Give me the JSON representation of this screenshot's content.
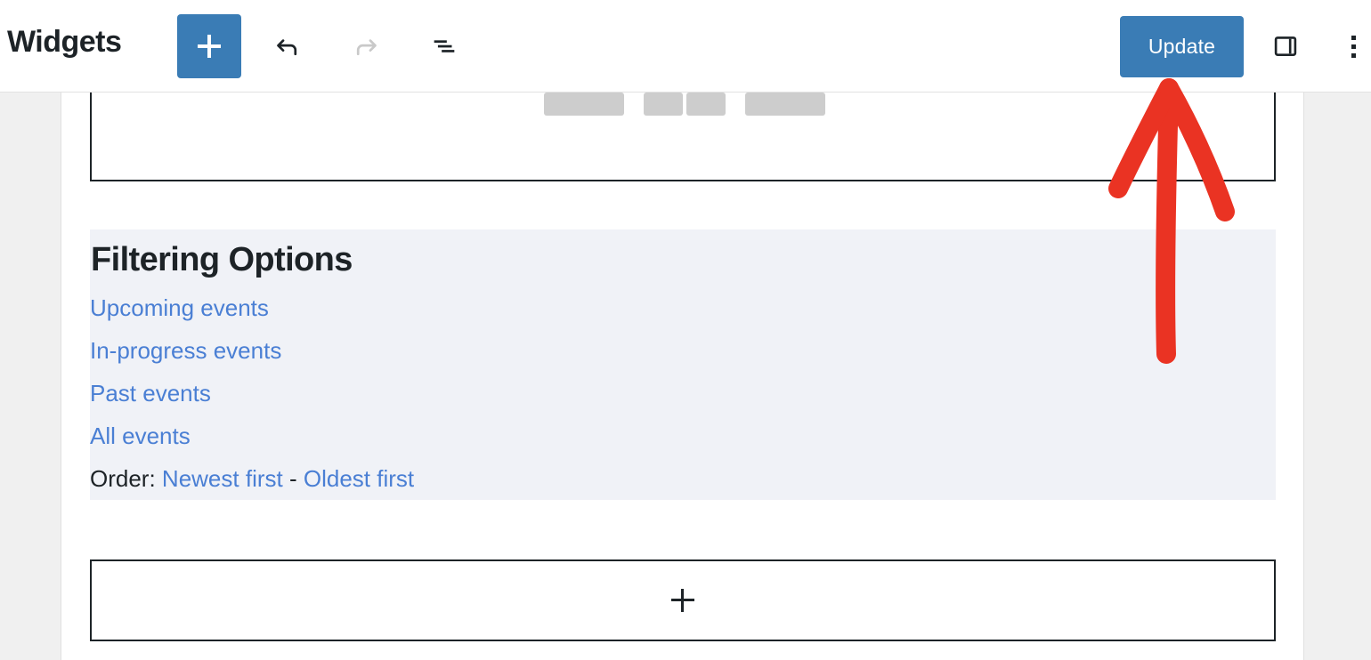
{
  "header": {
    "title": "Widgets",
    "add_block_icon": "plus-icon",
    "undo_icon": "undo-arrow-icon",
    "redo_icon": "redo-arrow-icon",
    "list_view_icon": "list-view-icon",
    "update_label": "Update",
    "sidebar_toggle_icon": "sidebar-panel-icon",
    "options_icon": "kebab-menu-icon",
    "accent_color": "#3a7cb5"
  },
  "canvas": {
    "partial_block": {
      "name": "calendar-navigation-block",
      "skeleton_bars": 4
    },
    "filter_block": {
      "title": "Filtering Options",
      "background_color": "#f0f2f7",
      "links": [
        "Upcoming events",
        "In-progress events",
        "Past events",
        "All events"
      ],
      "order_label": "Order:",
      "order_options": [
        "Newest first",
        "Oldest first"
      ],
      "order_separator": "-",
      "link_color": "#4a7fd4"
    },
    "appender": {
      "icon": "plus-icon",
      "label": ""
    }
  },
  "annotation": {
    "shape": "hand-drawn-arrow",
    "color": "#ea3323",
    "points_to": "Update"
  }
}
